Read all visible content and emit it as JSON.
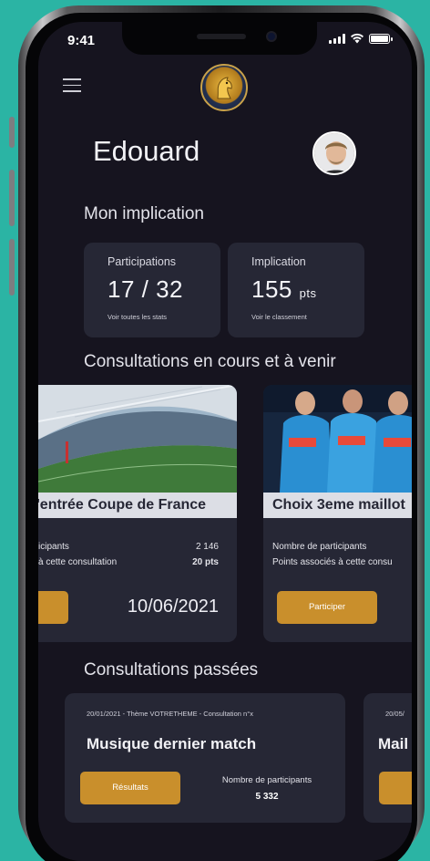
{
  "status_bar": {
    "time": "9:41"
  },
  "header": {
    "menu_icon": "hamburger-menu-icon",
    "logo_icon": "club-crest-icon"
  },
  "user": {
    "name": "Edouard",
    "avatar_icon": "user-avatar"
  },
  "implication": {
    "title": "Mon implication",
    "cards": [
      {
        "label": "Participations",
        "value": "17 / 32",
        "unit": "",
        "link": "Voir toutes les stats"
      },
      {
        "label": "Implication",
        "value": "155",
        "unit": "pts",
        "link": "Voir le classement"
      }
    ]
  },
  "current": {
    "title": "Consultations en cours et à venir",
    "cards": [
      {
        "title": "'entrée Coupe de France",
        "row1_label": "icipants",
        "row1_value": "2 146",
        "row2_label": "à cette consultation",
        "row2_value": "20 pts",
        "date": "10/06/2021"
      },
      {
        "title": "Choix 3eme maillot",
        "row1_label": "Nombre de participants",
        "row2_label": "Points associés à cette consu",
        "button": "Participer"
      }
    ]
  },
  "past": {
    "title": "Consultations passées",
    "cards": [
      {
        "meta": "20/01/2021 - Thème VOTRETHEME - Consultation n°x",
        "title": "Musique dernier match",
        "button": "Résultats",
        "stat_label": "Nombre de participants",
        "stat_value": "5 332"
      },
      {
        "meta": "20/05/",
        "title": "Mail"
      }
    ]
  },
  "colors": {
    "background": "#2bb4a4",
    "screen": "#16141f",
    "card": "#262735",
    "accent": "#c98f2c"
  }
}
